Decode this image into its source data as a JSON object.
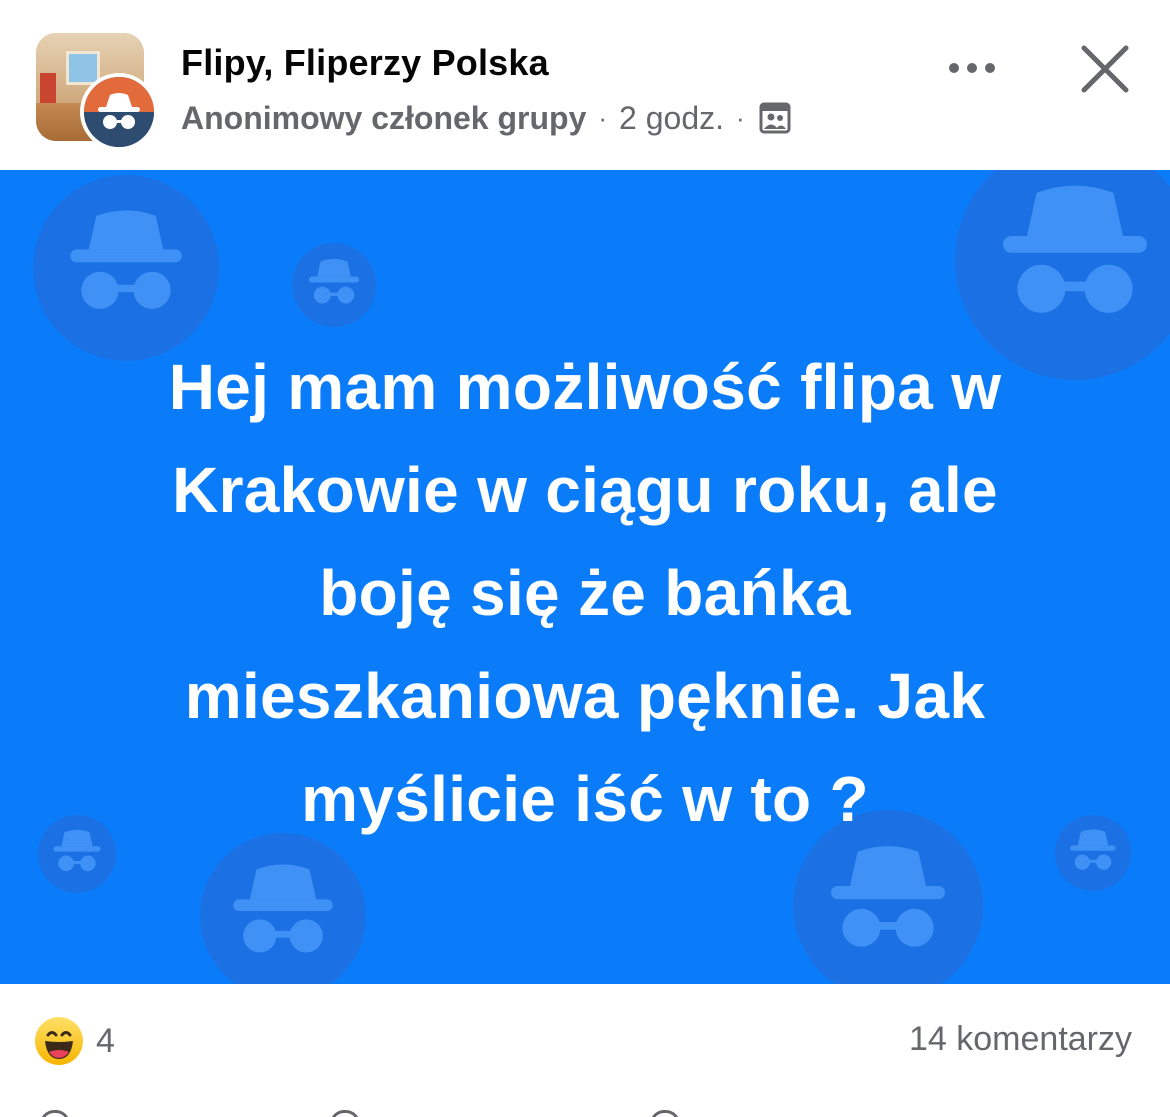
{
  "header": {
    "group_name": "Flipy, Fliperzy Polska",
    "author": "Anonimowy członek grupy",
    "separator": "·",
    "time": "2 godz.",
    "icons": {
      "group_avatar": "room-photo-avatar",
      "anon_badge": "anonymous-incognito-icon",
      "audience": "group-members-icon",
      "more": "more-dots-icon",
      "close": "close-x-icon"
    }
  },
  "content": {
    "background_color": "#0a7cf9",
    "text_lines": [
      "Hej mam możliwość flipa w",
      "Krakowie w ciągu roku, ale",
      "boję się że bańka",
      "mieszkaniowa pęknie. Jak",
      "myślicie iść w to ?"
    ]
  },
  "footer": {
    "reaction_icon": "haha-emoji-icon",
    "reaction_count": "4",
    "comments_label": "14 komentarzy"
  }
}
